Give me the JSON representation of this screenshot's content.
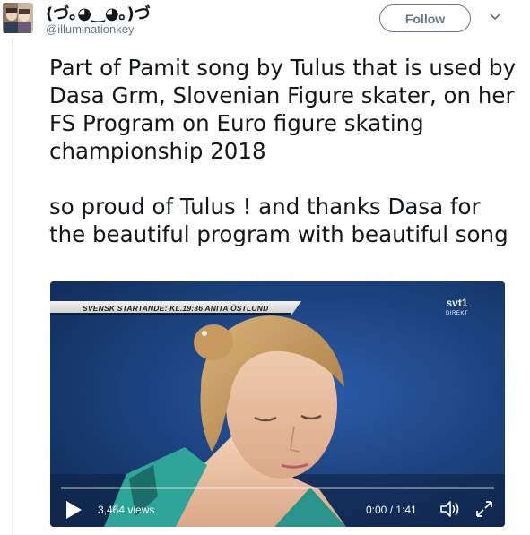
{
  "author": {
    "display_name": "(づ｡◕‿◕｡)づ",
    "handle": "@illuminationkey"
  },
  "actions": {
    "follow_label": "Follow"
  },
  "tweet": {
    "paragraphs": [
      "Part of Pamit song by Tulus that is used by Dasa Grm, Slovenian Figure skater, on her FS Program on Euro figure skating championship 2018",
      "so proud of Tulus ! and thanks Dasa for the beautiful program with beautiful song"
    ]
  },
  "video": {
    "banner_text": "SVENSK STARTANDE: KL.19:36  ANITA ÖSTLUND",
    "channel_logo": "svt1",
    "channel_sub": "DIREKT",
    "views": "3,464 views",
    "time": "0:00 / 1:41",
    "progress": 0
  },
  "icons": {
    "avatar": "avatar-image",
    "caret": "chevron-down-icon",
    "play": "play-icon",
    "volume": "volume-icon",
    "fullscreen": "fullscreen-icon"
  }
}
